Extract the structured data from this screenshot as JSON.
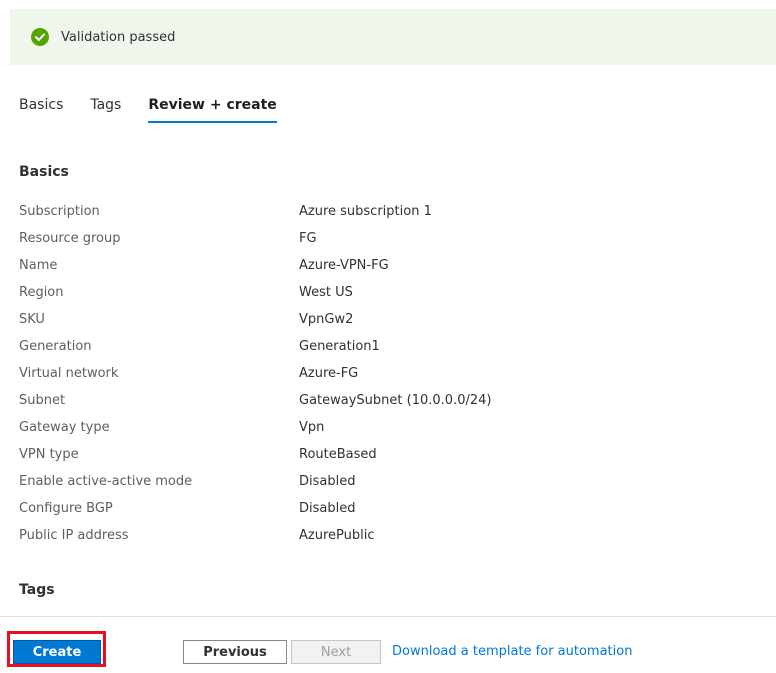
{
  "banner": {
    "text": "Validation passed",
    "icon": "check-circle-icon",
    "color": "#57a300"
  },
  "tabs": [
    {
      "label": "Basics",
      "active": false
    },
    {
      "label": "Tags",
      "active": false
    },
    {
      "label": "Review + create",
      "active": true
    }
  ],
  "sections": {
    "basics": "Basics",
    "tags": "Tags"
  },
  "basics_rows": [
    {
      "key": "Subscription",
      "value": "Azure subscription 1"
    },
    {
      "key": "Resource group",
      "value": "FG"
    },
    {
      "key": "Name",
      "value": "Azure-VPN-FG"
    },
    {
      "key": "Region",
      "value": "West US"
    },
    {
      "key": "SKU",
      "value": "VpnGw2"
    },
    {
      "key": "Generation",
      "value": "Generation1"
    },
    {
      "key": "Virtual network",
      "value": "Azure-FG"
    },
    {
      "key": "Subnet",
      "value": "GatewaySubnet (10.0.0.0/24)"
    },
    {
      "key": "Gateway type",
      "value": "Vpn"
    },
    {
      "key": "VPN type",
      "value": "RouteBased"
    },
    {
      "key": "Enable active-active mode",
      "value": "Disabled"
    },
    {
      "key": "Configure BGP",
      "value": "Disabled"
    },
    {
      "key": "Public IP address",
      "value": "AzurePublic"
    }
  ],
  "footer": {
    "create": "Create",
    "previous": "Previous",
    "next": "Next",
    "download_link": "Download a template for automation"
  },
  "colors": {
    "accent": "#0078d4",
    "highlight": "#e81123",
    "banner_bg": "#eff6ec"
  }
}
